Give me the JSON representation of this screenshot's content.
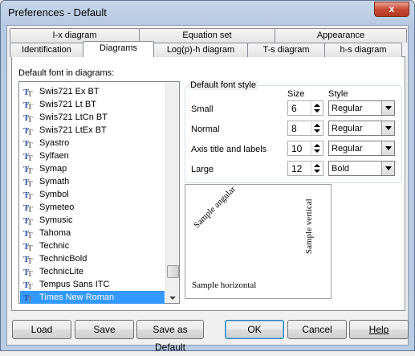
{
  "window": {
    "title": "Preferences - Default",
    "close_label": "x"
  },
  "tabs": {
    "back_row": [
      {
        "label": "I-x diagram"
      },
      {
        "label": "Equation set"
      },
      {
        "label": "Appearance"
      }
    ],
    "front_row": [
      {
        "label": "Identification"
      },
      {
        "label": "Diagrams",
        "active": true
      },
      {
        "label": "Log(p)-h diagram"
      },
      {
        "label": "T-s diagram"
      },
      {
        "label": "h-s diagram"
      }
    ]
  },
  "font_list": {
    "label": "Default font in diagrams:",
    "items": [
      {
        "name": "Swis721 Ex BT"
      },
      {
        "name": "Swis721 Lt BT"
      },
      {
        "name": "Swis721 LtCn BT"
      },
      {
        "name": "Swis721 LtEx BT"
      },
      {
        "name": "Syastro"
      },
      {
        "name": "Sylfaen"
      },
      {
        "name": "Symap"
      },
      {
        "name": "Symath"
      },
      {
        "name": "Symbol"
      },
      {
        "name": "Symeteo"
      },
      {
        "name": "Symusic"
      },
      {
        "name": "Tahoma"
      },
      {
        "name": "Technic"
      },
      {
        "name": "TechnicBold"
      },
      {
        "name": "TechnicLite"
      },
      {
        "name": "Tempus Sans ITC"
      },
      {
        "name": "Times New Roman",
        "selected": true
      }
    ],
    "icon": "truetype-font-icon"
  },
  "font_style": {
    "title": "Default font style",
    "size_header": "Size",
    "style_header": "Style",
    "rows": [
      {
        "label": "Small",
        "size": "6",
        "style": "Regular"
      },
      {
        "label": "Normal",
        "size": "8",
        "style": "Regular"
      },
      {
        "label": "Axis title and labels",
        "size": "10",
        "style": "Regular"
      },
      {
        "label": "Large",
        "size": "12",
        "style": "Bold"
      }
    ]
  },
  "sample": {
    "angular": "Sample angular",
    "vertical": "Sample vertical",
    "horizontal": "Sample horizontal"
  },
  "buttons": {
    "load": "Load",
    "save": "Save",
    "save_as_default": "Save as Default",
    "ok": "OK",
    "cancel": "Cancel",
    "help": "Help"
  },
  "colors": {
    "selection": "#3399ff",
    "close_button": "#c74c34",
    "tt_icon_blue": "#2b4fa8",
    "tt_icon_gray": "#7a7a7a"
  }
}
